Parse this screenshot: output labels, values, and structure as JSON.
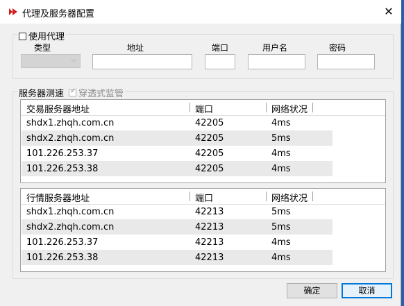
{
  "dialog": {
    "title": "代理及服务器配置"
  },
  "proxy": {
    "checkbox_label": "使用代理",
    "checked": false,
    "labels": {
      "type": "类型",
      "address": "地址",
      "port": "端口",
      "user": "用户名",
      "password": "密码"
    },
    "values": {
      "type": "",
      "address": "",
      "port": "",
      "user": "",
      "password": ""
    }
  },
  "speed_test": {
    "group_label": "服务器测速",
    "transparent_label": "穿透式监管",
    "transparent_checked": true
  },
  "trade_servers": {
    "headers": [
      "交易服务器地址",
      "端口",
      "网络状况"
    ],
    "rows": [
      [
        "shdx1.zhqh.com.cn",
        "42205",
        "4ms"
      ],
      [
        "shdx2.zhqh.com.cn",
        "42205",
        "5ms"
      ],
      [
        "101.226.253.37",
        "42205",
        "4ms"
      ],
      [
        "101.226.253.38",
        "42205",
        "4ms"
      ]
    ]
  },
  "quote_servers": {
    "headers": [
      "行情服务器地址",
      "端口",
      "网络状况"
    ],
    "rows": [
      [
        "shdx1.zhqh.com.cn",
        "42213",
        "5ms"
      ],
      [
        "shdx2.zhqh.com.cn",
        "42213",
        "5ms"
      ],
      [
        "101.226.253.37",
        "42213",
        "4ms"
      ],
      [
        "101.226.253.38",
        "42213",
        "4ms"
      ]
    ]
  },
  "buttons": {
    "ok": "确定",
    "cancel": "取消"
  }
}
